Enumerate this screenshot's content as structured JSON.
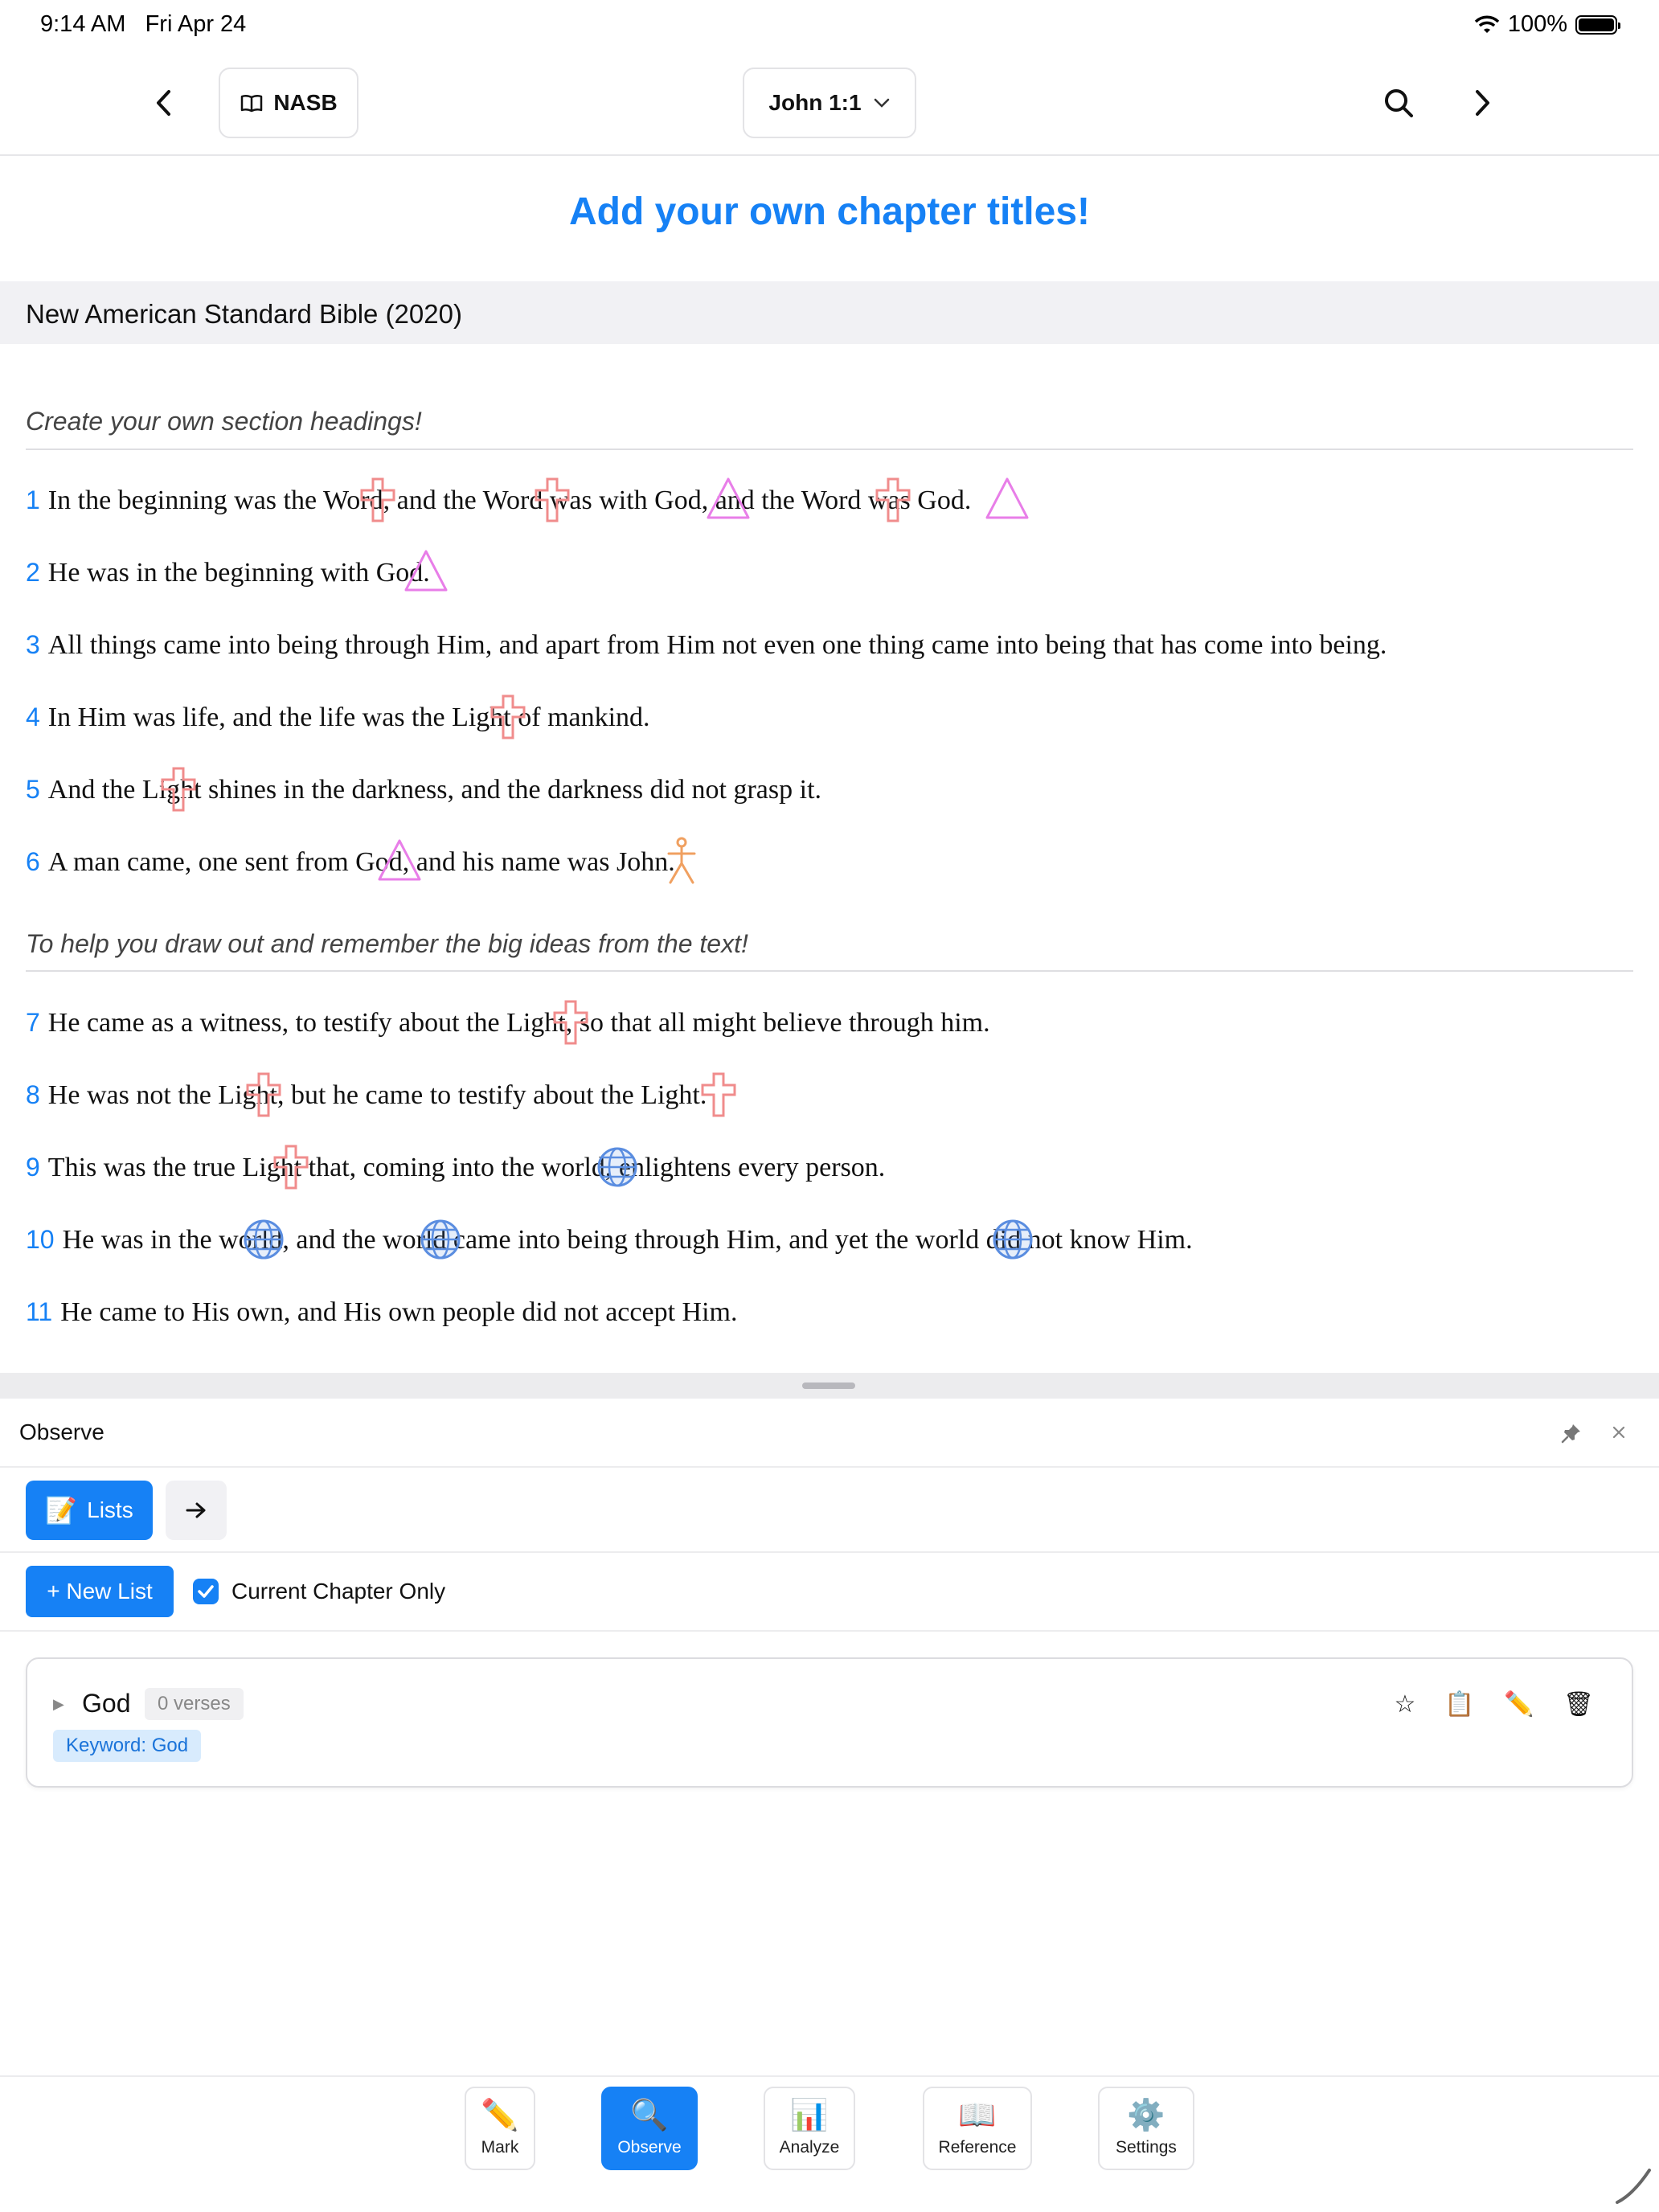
{
  "status": {
    "time": "9:14 AM",
    "date": "Fri Apr 24",
    "battery": "100%"
  },
  "nav": {
    "version_label": "NASB",
    "reference_label": "John 1:1"
  },
  "chapter_title": "Add your own chapter titles!",
  "version_name": "New American Standard Bible (2020)",
  "headings": [
    "Create your own section headings!",
    "To help you draw out and remember the big ideas from the text!"
  ],
  "verses": [
    {
      "num": "1",
      "text": "In the beginning was the Word, and the Word was with God, and the Word was God."
    },
    {
      "num": "2",
      "text": "He was in the beginning with God."
    },
    {
      "num": "3",
      "text": "All things came into being through Him, and apart from Him not even one thing came into being that has come into being."
    },
    {
      "num": "4",
      "text": "In Him was life, and the life was the Light of mankind."
    },
    {
      "num": "5",
      "text": "And the Light shines in the darkness, and the darkness did not grasp it."
    },
    {
      "num": "6",
      "text": "A man came, one sent from God, and his name was John."
    },
    {
      "num": "7",
      "text": "He came as a witness, to testify about the Light, so that all might believe through him."
    },
    {
      "num": "8",
      "text": "He was not the Light, but he came to testify about the Light."
    },
    {
      "num": "9",
      "text": "This was the true Light that, coming into the world, enlightens every person."
    },
    {
      "num": "10",
      "text": "He was in the world, and the world came into being through Him, and yet the world did not know Him."
    },
    {
      "num": "11",
      "text": "He came to His own, and His own people did not accept Him."
    }
  ],
  "panel": {
    "title": "Observe",
    "lists_tab": "Lists",
    "new_list": "+ New List",
    "current_chapter_only": "Current Chapter Only",
    "list_name": "God",
    "verse_count": "0 verses",
    "keyword_badge": "Keyword: God"
  },
  "tabs": [
    {
      "label": "Mark",
      "icon": "pencil-icon"
    },
    {
      "label": "Observe",
      "icon": "magnifier-icon"
    },
    {
      "label": "Analyze",
      "icon": "bar-chart-icon"
    },
    {
      "label": "Reference",
      "icon": "book-icon"
    },
    {
      "label": "Settings",
      "icon": "gear-icon"
    }
  ],
  "colors": {
    "accent": "#1681f5",
    "cross_mark": "#f08080",
    "triangle_mark": "#e070e0",
    "globe_mark": "#5a8de0",
    "person_mark": "#f0a060"
  }
}
